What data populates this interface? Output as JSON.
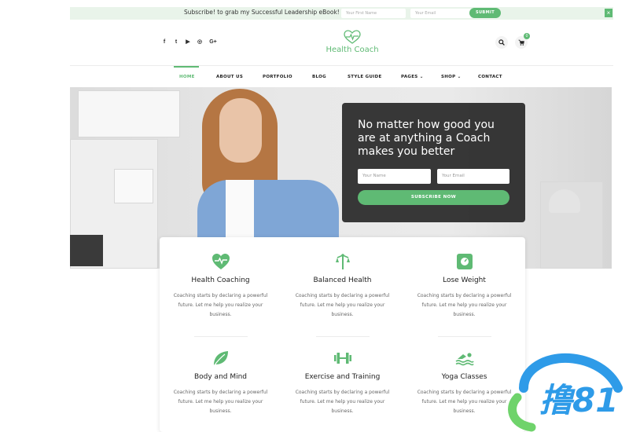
{
  "promo": {
    "text": "Subscribe! to grab my Successful Leadership eBook!",
    "first_name_placeholder": "Your First Name",
    "email_placeholder": "Your Email",
    "submit_label": "SUBMIT",
    "close_label": "×"
  },
  "header": {
    "social_icons": [
      "facebook-icon",
      "twitter-icon",
      "youtube-icon",
      "instagram-icon",
      "google-plus-icon"
    ],
    "social_glyphs": [
      "f",
      "t",
      "▶",
      "◎",
      "G+"
    ],
    "logo_text": "Health Coach",
    "cart_count": "0"
  },
  "nav": {
    "items": [
      {
        "label": "HOME"
      },
      {
        "label": "ABOUT US"
      },
      {
        "label": "PORTFOLIO"
      },
      {
        "label": "BLOG"
      },
      {
        "label": "STYLE GUIDE"
      },
      {
        "label": "PAGES ⌄"
      },
      {
        "label": "SHOP ⌄"
      },
      {
        "label": "CONTACT"
      }
    ]
  },
  "hero": {
    "title": "No matter how good you are at anything a Coach makes you better",
    "name_placeholder": "Your Name",
    "email_placeholder": "Your Email",
    "button_label": "SUBSCRIBE NOW"
  },
  "services": [
    {
      "title": "Health Coaching",
      "desc": "Coaching starts by declaring a powerful future. Let me help you realize your business.",
      "icon": "heart-pulse-icon"
    },
    {
      "title": "Balanced Health",
      "desc": "Coaching starts by declaring a powerful future. Let me help you realize your business.",
      "icon": "balance-icon"
    },
    {
      "title": "Lose Weight",
      "desc": "Coaching starts by declaring a powerful future. Let me help you realize your business.",
      "icon": "scale-icon"
    },
    {
      "title": "Body and Mind",
      "desc": "Coaching starts by declaring a powerful future. Let me help you realize your business.",
      "icon": "leaf-icon"
    },
    {
      "title": "Exercise and Training",
      "desc": "Coaching starts by declaring a powerful future. Let me help you realize your business.",
      "icon": "dumbbell-icon"
    },
    {
      "title": "Yoga Classes",
      "desc": "Coaching starts by declaring a powerful future. Let me help you realize your business.",
      "icon": "swimmer-icon"
    }
  ],
  "colors": {
    "accent": "#5fba74",
    "promo_bg": "#e9f4ea",
    "hero_card": "#1e1e1e"
  },
  "watermark": {
    "text": "撸81"
  }
}
